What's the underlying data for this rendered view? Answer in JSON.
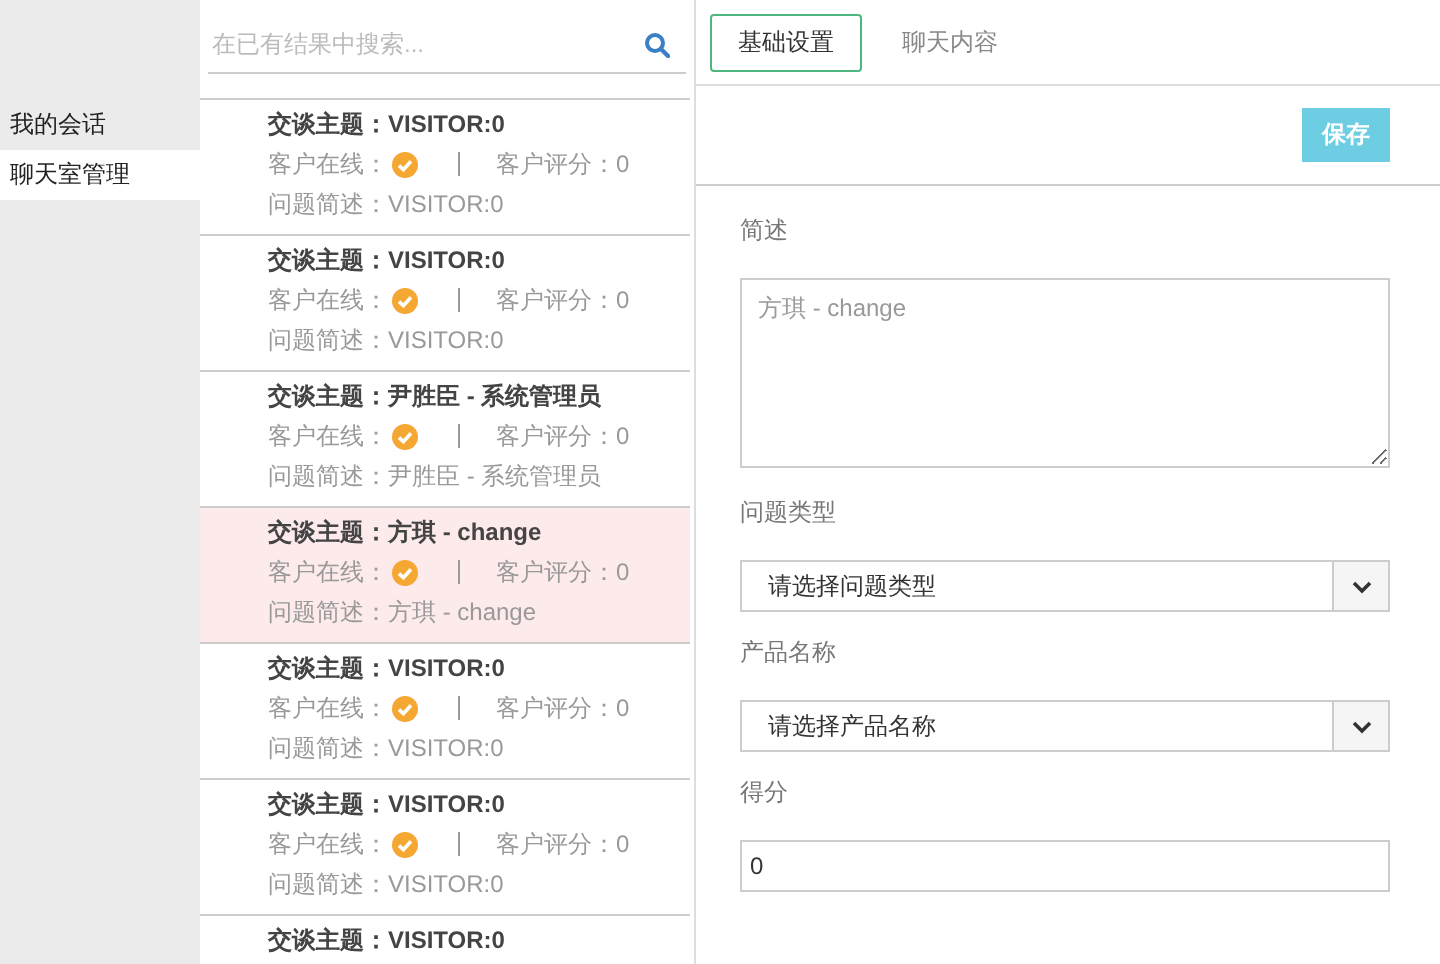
{
  "sidebar": {
    "items": [
      {
        "label": "我的会话",
        "selected": false
      },
      {
        "label": "聊天室管理",
        "selected": true
      }
    ]
  },
  "search": {
    "placeholder": "在已有结果中搜索..."
  },
  "conversations": [
    {
      "title_label": "交谈主题：",
      "title": "VISITOR:0",
      "online_label": "客户在线：",
      "online": true,
      "rating_label": "客户评分：",
      "rating": "0",
      "desc_label": "问题简述：",
      "desc": "VISITOR:0",
      "selected": false
    },
    {
      "title_label": "交谈主题：",
      "title": "VISITOR:0",
      "online_label": "客户在线：",
      "online": true,
      "rating_label": "客户评分：",
      "rating": "0",
      "desc_label": "问题简述：",
      "desc": "VISITOR:0",
      "selected": false
    },
    {
      "title_label": "交谈主题：",
      "title": "尹胜臣 - 系统管理员",
      "online_label": "客户在线：",
      "online": true,
      "rating_label": "客户评分：",
      "rating": "0",
      "desc_label": "问题简述：",
      "desc": "尹胜臣 - 系统管理员",
      "selected": false
    },
    {
      "title_label": "交谈主题：",
      "title": "方琪 - change",
      "online_label": "客户在线：",
      "online": true,
      "rating_label": "客户评分：",
      "rating": "0",
      "desc_label": "问题简述：",
      "desc": "方琪 - change",
      "selected": true
    },
    {
      "title_label": "交谈主题：",
      "title": "VISITOR:0",
      "online_label": "客户在线：",
      "online": true,
      "rating_label": "客户评分：",
      "rating": "0",
      "desc_label": "问题简述：",
      "desc": "VISITOR:0",
      "selected": false
    },
    {
      "title_label": "交谈主题：",
      "title": "VISITOR:0",
      "online_label": "客户在线：",
      "online": true,
      "rating_label": "客户评分：",
      "rating": "0",
      "desc_label": "问题简述：",
      "desc": "VISITOR:0",
      "selected": false
    },
    {
      "title_label": "交谈主题：",
      "title": "VISITOR:0",
      "selected": false
    }
  ],
  "tabs": [
    {
      "label": "基础设置",
      "selected": true
    },
    {
      "label": "聊天内容",
      "selected": false
    }
  ],
  "save_button": "保存",
  "form": [
    {
      "kind": "textarea",
      "label": "简述",
      "placeholder": "方琪 - change"
    },
    {
      "kind": "select",
      "label": "问题类型",
      "value": "请选择问题类型"
    },
    {
      "kind": "select",
      "label": "产品名称",
      "value": "请选择产品名称"
    },
    {
      "kind": "input",
      "label": "得分",
      "value": "0"
    }
  ]
}
